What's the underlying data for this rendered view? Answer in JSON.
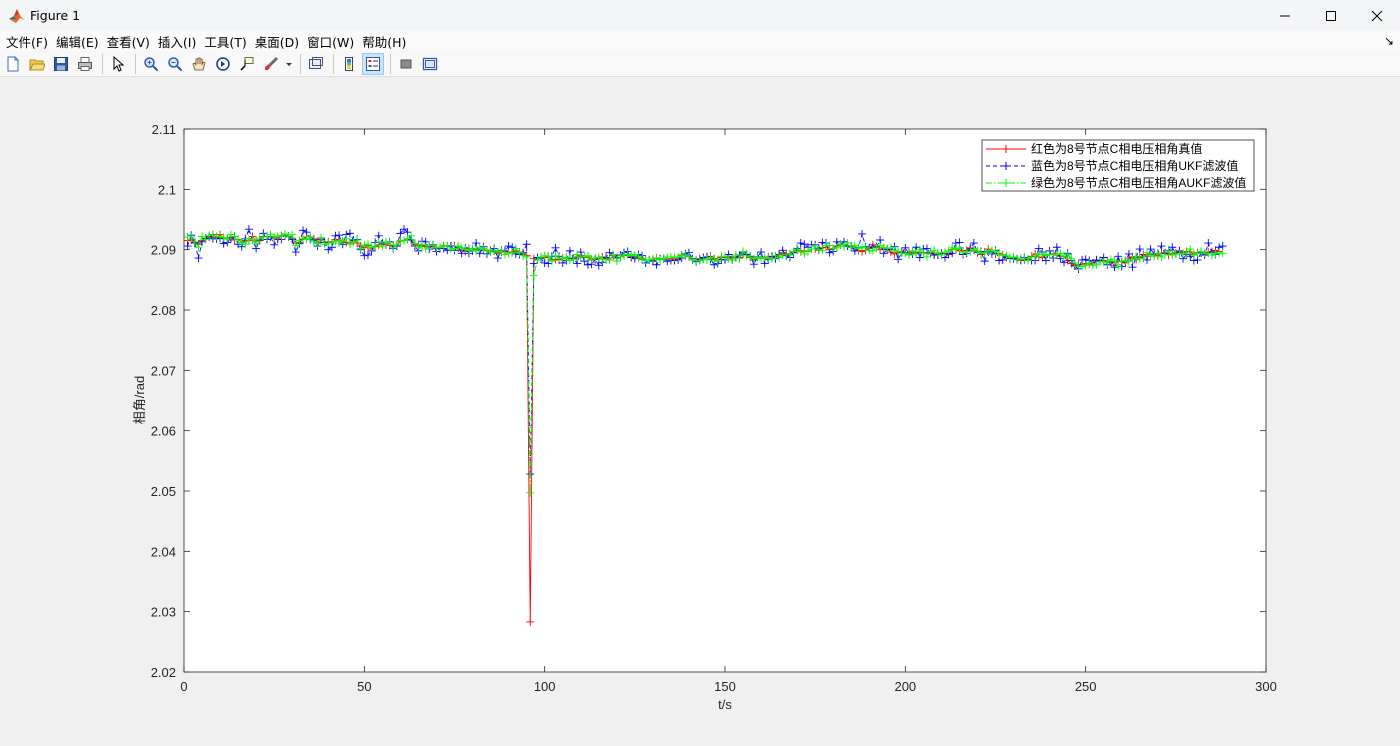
{
  "window": {
    "title": "Figure 1"
  },
  "menu": {
    "items": [
      "文件(F)",
      "编辑(E)",
      "查看(V)",
      "插入(I)",
      "工具(T)",
      "桌面(D)",
      "窗口(W)",
      "帮助(H)"
    ]
  },
  "toolbar": {
    "icons": [
      "new-figure-icon",
      "open-file-icon",
      "save-icon",
      "print-icon",
      "pointer-icon",
      "zoom-in-icon",
      "zoom-out-icon",
      "pan-icon",
      "rotate-3d-icon",
      "data-cursor-icon",
      "brush-icon",
      "brush-dropdown-icon",
      "link-plot-icon",
      "colorbar-icon",
      "legend-icon",
      "hide-plot-tools-icon",
      "show-plot-tools-icon"
    ]
  },
  "chart_data": {
    "type": "line",
    "title": "",
    "xlabel": "t/s",
    "ylabel": "相角/rad",
    "xlim": [
      0,
      300
    ],
    "ylim": [
      2.02,
      2.11
    ],
    "xticks": [
      0,
      50,
      100,
      150,
      200,
      250,
      300
    ],
    "yticks": [
      2.02,
      2.03,
      2.04,
      2.05,
      2.06,
      2.07,
      2.08,
      2.09,
      2.1,
      2.11
    ],
    "xtick_labels": [
      "0",
      "50",
      "100",
      "150",
      "200",
      "250",
      "300"
    ],
    "ytick_labels": [
      "2.02",
      "2.03",
      "2.04",
      "2.05",
      "2.06",
      "2.07",
      "2.08",
      "2.09",
      "2.1",
      "2.11"
    ],
    "grid": false,
    "legend_position": "top-right",
    "x_start": 1,
    "x_step": 1,
    "series": [
      {
        "name": "红色为8号节点C相电压相角真值",
        "color": "#ff0000",
        "linestyle": "solid",
        "marker": "+",
        "values": [
          2.0915,
          2.0916,
          2.0912,
          2.0909,
          2.0915,
          2.0919,
          2.0921,
          2.0925,
          2.092,
          2.0925,
          2.0918,
          2.0918,
          2.092,
          2.0916,
          2.0917,
          2.0912,
          2.0915,
          2.0915,
          2.0922,
          2.0914,
          2.0915,
          2.0922,
          2.0922,
          2.0921,
          2.0919,
          2.0919,
          2.0923,
          2.0924,
          2.0921,
          2.0919,
          2.0911,
          2.0912,
          2.0917,
          2.0921,
          2.0921,
          2.0918,
          2.0912,
          2.0918,
          2.0912,
          2.0913,
          2.0911,
          2.0917,
          2.0916,
          2.0913,
          2.0912,
          2.0911,
          2.0915,
          2.0911,
          2.0906,
          2.0903,
          2.0907,
          2.0901,
          2.0905,
          2.0908,
          2.0909,
          2.0908,
          2.0907,
          2.0906,
          2.0906,
          2.0914,
          2.0915,
          2.0917,
          2.0916,
          2.0908,
          2.0906,
          2.0907,
          2.0905,
          2.0905,
          2.0906,
          2.0902,
          2.0902,
          2.0907,
          2.0906,
          2.0906,
          2.0906,
          2.0903,
          2.0899,
          2.0897,
          2.0902,
          2.0901,
          2.0901,
          2.0899,
          2.0899,
          2.0899,
          2.0899,
          2.0898,
          2.0894,
          2.0896,
          2.0897,
          2.0896,
          2.0896,
          2.0898,
          2.0896,
          2.0893,
          2.089,
          2.0283,
          2.0885,
          2.0883,
          2.0888,
          2.0887,
          2.0889,
          2.0883,
          2.0884,
          2.0883,
          2.0886,
          2.0886,
          2.0885,
          2.0885,
          2.0888,
          2.089,
          2.0887,
          2.0888,
          2.0883,
          2.0885,
          2.0885,
          2.0888,
          2.0885,
          2.0883,
          2.089,
          2.0887,
          2.0888,
          2.089,
          2.0892,
          2.0888,
          2.0889,
          2.0887,
          2.0884,
          2.0883,
          2.0883,
          2.0882,
          2.0886,
          2.0885,
          2.0885,
          2.0884,
          2.0885,
          2.0883,
          2.0885,
          2.0891,
          2.089,
          2.0889,
          2.0883,
          2.0883,
          2.0885,
          2.0886,
          2.0888,
          2.0889,
          2.0885,
          2.0881,
          2.0887,
          2.0887,
          2.0889,
          2.0886,
          2.0887,
          2.0887,
          2.0893,
          2.0892,
          2.0887,
          2.0883,
          2.0888,
          2.0888,
          2.0886,
          2.0888,
          2.0888,
          2.0888,
          2.0892,
          2.0895,
          2.0893,
          2.0893,
          2.0895,
          2.0899,
          2.0898,
          2.0898,
          2.0897,
          2.0901,
          2.0901,
          2.0899,
          2.0903,
          2.0904,
          2.09,
          2.0902,
          2.0906,
          2.0908,
          2.0908,
          2.0906,
          2.0904,
          2.0902,
          2.0899,
          2.0897,
          2.0899,
          2.0902,
          2.0908,
          2.0905,
          2.09,
          2.0903,
          2.0901,
          2.0896,
          2.0893,
          2.0895,
          2.0897,
          2.0895,
          2.0895,
          2.0896,
          2.0894,
          2.0895,
          2.0895,
          2.0894,
          2.0895,
          2.0893,
          2.0892,
          2.0894,
          2.0894,
          2.0892,
          2.09,
          2.0901,
          2.0898,
          2.0898,
          2.0899,
          2.0903,
          2.0899,
          2.0897,
          2.0892,
          2.0896,
          2.0901,
          2.0897,
          2.0893,
          2.0894,
          2.0891,
          2.0887,
          2.0885,
          2.0887,
          2.0885,
          2.0882,
          2.0883,
          2.0884,
          2.0889,
          2.0893,
          2.0888,
          2.0887,
          2.0891,
          2.0892,
          2.0893,
          2.0891,
          2.0889,
          2.0889,
          2.0882,
          2.0877,
          2.0874,
          2.0875,
          2.0876,
          2.0877,
          2.0876,
          2.0878,
          2.0881,
          2.0882,
          2.0881,
          2.0881,
          2.088,
          2.0874,
          2.0881,
          2.088,
          2.0878,
          2.0886,
          2.0888,
          2.0884,
          2.0887,
          2.0892,
          2.0889,
          2.0893,
          2.0893,
          2.089,
          2.0894,
          2.0895,
          2.0891,
          2.0894,
          2.0895,
          2.0896,
          2.0894,
          2.0897,
          2.0896,
          2.0892,
          2.0895,
          2.0894,
          2.0893,
          2.0896,
          2.0897,
          2.0899,
          2.0897
        ]
      },
      {
        "name": "蓝色为8号节点C相电压相角UKF滤波值",
        "color": "#0000ff",
        "linestyle": "dashed",
        "marker": "+",
        "values": [
          2.0906,
          2.0924,
          2.0911,
          2.0886,
          2.0913,
          2.0918,
          2.0922,
          2.0918,
          2.0918,
          2.0919,
          2.091,
          2.0912,
          2.0919,
          2.0922,
          2.0909,
          2.0905,
          2.0918,
          2.0934,
          2.0916,
          2.0902,
          2.0916,
          2.0927,
          2.0917,
          2.0922,
          2.0908,
          2.0917,
          2.0917,
          2.0926,
          2.0922,
          2.0917,
          2.0896,
          2.091,
          2.0932,
          2.0929,
          2.0917,
          2.0916,
          2.0906,
          2.0917,
          2.0912,
          2.09,
          2.0904,
          2.0923,
          2.0924,
          2.0909,
          2.0925,
          2.0927,
          2.0916,
          2.0917,
          2.09,
          2.089,
          2.0891,
          2.0898,
          2.0912,
          2.0923,
          2.0911,
          2.0911,
          2.0913,
          2.0902,
          2.0906,
          2.0927,
          2.0934,
          2.0929,
          2.0916,
          2.0906,
          2.0898,
          2.0914,
          2.0913,
          2.0901,
          2.0908,
          2.0897,
          2.0902,
          2.0902,
          2.0899,
          2.0906,
          2.0899,
          2.0904,
          2.0894,
          2.0903,
          2.0894,
          2.0898,
          2.0911,
          2.0894,
          2.0905,
          2.0893,
          2.0897,
          2.0902,
          2.0886,
          2.0899,
          2.0898,
          2.0906,
          2.0904,
          2.0893,
          2.0892,
          2.0895,
          2.0909,
          2.0528,
          2.0877,
          2.0887,
          2.0885,
          2.0878,
          2.0877,
          2.0889,
          2.0903,
          2.0889,
          2.0878,
          2.0882,
          2.0898,
          2.0886,
          2.0877,
          2.0896,
          2.0881,
          2.0875,
          2.0876,
          2.0884,
          2.0874,
          2.0879,
          2.0887,
          2.0895,
          2.0892,
          2.0886,
          2.0891,
          2.0895,
          2.0897,
          2.0887,
          2.0885,
          2.0892,
          2.089,
          2.0878,
          2.0883,
          2.0881,
          2.0875,
          2.0885,
          2.0885,
          2.0881,
          2.0882,
          2.0882,
          2.0883,
          2.0886,
          2.0893,
          2.0895,
          2.0885,
          2.088,
          2.0883,
          2.0887,
          2.0888,
          2.0884,
          2.0875,
          2.0877,
          2.0884,
          2.0883,
          2.0892,
          2.0883,
          2.0888,
          2.0891,
          2.0895,
          2.0892,
          2.0889,
          2.0876,
          2.0888,
          2.0896,
          2.0877,
          2.0884,
          2.0889,
          2.0885,
          2.0891,
          2.0899,
          2.089,
          2.0887,
          2.0895,
          2.0902,
          2.0911,
          2.0909,
          2.0904,
          2.0908,
          2.0908,
          2.0902,
          2.0912,
          2.0911,
          2.0895,
          2.0897,
          2.0913,
          2.0909,
          2.0913,
          2.0906,
          2.0906,
          2.0898,
          2.0903,
          2.0926,
          2.0905,
          2.0903,
          2.0904,
          2.0904,
          2.0916,
          2.0894,
          2.09,
          2.09,
          2.0905,
          2.0884,
          2.0895,
          2.0903,
          2.0893,
          2.0893,
          2.0904,
          2.0887,
          2.0901,
          2.0902,
          2.0894,
          2.0891,
          2.0891,
          2.0894,
          2.0887,
          2.0893,
          2.0894,
          2.0911,
          2.0912,
          2.0892,
          2.0894,
          2.0902,
          2.0911,
          2.0895,
          2.0897,
          2.0881,
          2.0896,
          2.0893,
          2.0899,
          2.0882,
          2.0883,
          2.0888,
          2.0886,
          2.0885,
          2.0884,
          2.0883,
          2.0887,
          2.0883,
          2.0882,
          2.0882,
          2.0902,
          2.0896,
          2.0882,
          2.0898,
          2.0886,
          2.0904,
          2.0885,
          2.0879,
          2.0894,
          2.0882,
          2.0873,
          2.0868,
          2.0883,
          2.0884,
          2.0882,
          2.0878,
          2.0883,
          2.0881,
          2.0887,
          2.0875,
          2.0879,
          2.0871,
          2.0889,
          2.0872,
          2.0881,
          2.0893,
          2.0871,
          2.0888,
          2.0901,
          2.0886,
          2.0883,
          2.0901,
          2.0893,
          2.0894,
          2.0906,
          2.0894,
          2.0899,
          2.0904,
          2.0893,
          2.0898,
          2.0885,
          2.0892,
          2.0889,
          2.0882,
          2.0883,
          2.0895,
          2.0891,
          2.0911,
          2.0895,
          2.0892,
          2.0904,
          2.0906
        ]
      },
      {
        "name": "绿色为8号节点C相电压相角AUKF滤波值",
        "color": "#00ff00",
        "linestyle": "dashdot",
        "marker": "+",
        "values": [
          2.0921,
          2.0921,
          2.0913,
          2.0904,
          2.0922,
          2.0917,
          2.0924,
          2.0924,
          2.0922,
          2.0922,
          2.092,
          2.0918,
          2.0925,
          2.0922,
          2.0916,
          2.0912,
          2.0909,
          2.0918,
          2.0916,
          2.0911,
          2.0919,
          2.0921,
          2.0921,
          2.0925,
          2.0921,
          2.0923,
          2.0923,
          2.0926,
          2.0921,
          2.0925,
          2.0907,
          2.0915,
          2.0919,
          2.0917,
          2.0921,
          2.0913,
          2.091,
          2.092,
          2.0909,
          2.0911,
          2.0911,
          2.0914,
          2.0911,
          2.0915,
          2.0918,
          2.0909,
          2.0913,
          2.0916,
          2.0902,
          2.0908,
          2.0909,
          2.0904,
          2.0906,
          2.0913,
          2.0905,
          2.0913,
          2.0912,
          2.0903,
          2.0908,
          2.0915,
          2.0915,
          2.0918,
          2.0923,
          2.091,
          2.0903,
          2.0909,
          2.0901,
          2.0907,
          2.0907,
          2.0903,
          2.0904,
          2.0907,
          2.0907,
          2.0901,
          2.0902,
          2.0906,
          2.0903,
          2.0901,
          2.0899,
          2.0902,
          2.0898,
          2.0903,
          2.0902,
          2.0898,
          2.0896,
          2.0899,
          2.0896,
          2.0898,
          2.0892,
          2.0894,
          2.0895,
          2.0902,
          2.0895,
          2.089,
          2.0888,
          2.0497,
          2.0857,
          2.0883,
          2.0888,
          2.089,
          2.0889,
          2.0881,
          2.089,
          2.0886,
          2.0885,
          2.0887,
          2.0882,
          2.0884,
          2.0892,
          2.0888,
          2.0888,
          2.089,
          2.0884,
          2.0886,
          2.0887,
          2.0884,
          2.0883,
          2.0883,
          2.0892,
          2.0881,
          2.0888,
          2.0891,
          2.0892,
          2.089,
          2.0892,
          2.0888,
          2.0885,
          2.0882,
          2.0883,
          2.0885,
          2.0885,
          2.0883,
          2.0885,
          2.0888,
          2.0888,
          2.0887,
          2.0888,
          2.089,
          2.0891,
          2.0888,
          2.0883,
          2.0882,
          2.0882,
          2.0884,
          2.0883,
          2.0887,
          2.0883,
          2.0881,
          2.0889,
          2.0889,
          2.0885,
          2.0883,
          2.0891,
          2.0885,
          2.0897,
          2.089,
          2.0888,
          2.0885,
          2.0887,
          2.0885,
          2.0887,
          2.0885,
          2.0885,
          2.089,
          2.0887,
          2.0891,
          2.0891,
          2.0891,
          2.0897,
          2.0901,
          2.0896,
          2.0893,
          2.0898,
          2.0901,
          2.0905,
          2.09,
          2.0899,
          2.0907,
          2.0907,
          2.0902,
          2.0903,
          2.0909,
          2.0905,
          2.0911,
          2.0904,
          2.0907,
          2.0902,
          2.0905,
          2.0903,
          2.0899,
          2.0898,
          2.0903,
          2.0907,
          2.0903,
          2.0902,
          2.0903,
          2.0899,
          2.0897,
          2.0894,
          2.0894,
          2.0891,
          2.0898,
          2.0893,
          2.09,
          2.0894,
          2.0888,
          2.0897,
          2.0899,
          2.0895,
          2.0891,
          2.0896,
          2.0898,
          2.0903,
          2.09,
          2.0903,
          2.0895,
          2.0897,
          2.0897,
          2.0901,
          2.0898,
          2.0895,
          2.0894,
          2.0898,
          2.0899,
          2.0897,
          2.0892,
          2.0892,
          2.089,
          2.0887,
          2.0888,
          2.0883,
          2.0886,
          2.0886,
          2.0882,
          2.0888,
          2.0888,
          2.0892,
          2.0893,
          2.089,
          2.0892,
          2.0892,
          2.0892,
          2.0894,
          2.0888,
          2.0892,
          2.0885,
          2.0878,
          2.0872,
          2.0872,
          2.0874,
          2.0878,
          2.0874,
          2.0875,
          2.088,
          2.088,
          2.0878,
          2.0884,
          2.0881,
          2.0872,
          2.0881,
          2.0882,
          2.088,
          2.0884,
          2.0889,
          2.0885,
          2.0886,
          2.0895,
          2.0891,
          2.0889,
          2.0894,
          2.0888,
          2.0891,
          2.0898,
          2.0891,
          2.0893,
          2.0893,
          2.0894,
          2.0893,
          2.0901,
          2.0891,
          2.0894,
          2.0897,
          2.0894,
          2.0894,
          2.0891,
          2.0893,
          2.0895,
          2.0894
        ]
      }
    ]
  }
}
